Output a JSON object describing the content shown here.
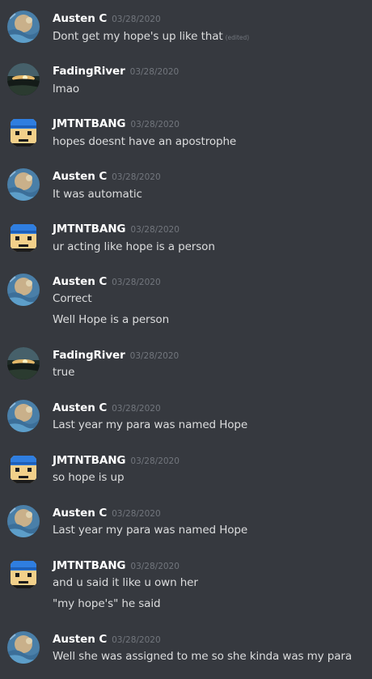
{
  "channel": {
    "edited_label": "(edited)"
  },
  "users": {
    "austen": {
      "name": "Austen C",
      "avatar": "abstract-blue-art-icon"
    },
    "fading": {
      "name": "FadingRiver",
      "avatar": "sunset-landscape-icon"
    },
    "jmtnt": {
      "name": "JMTNTBANG",
      "avatar": "pixel-character-icon"
    }
  },
  "messages": [
    {
      "author": "Austen C",
      "timestamp": "03/28/2020",
      "lines": [
        "Dont get my hope's up like that"
      ],
      "edited": true
    },
    {
      "author": "FadingRiver",
      "timestamp": "03/28/2020",
      "lines": [
        "lmao"
      ]
    },
    {
      "author": "JMTNTBANG",
      "timestamp": "03/28/2020",
      "lines": [
        "hopes doesnt have an apostrophe"
      ]
    },
    {
      "author": "Austen C",
      "timestamp": "03/28/2020",
      "lines": [
        "It was automatic"
      ]
    },
    {
      "author": "JMTNTBANG",
      "timestamp": "03/28/2020",
      "lines": [
        "ur acting like hope is a person"
      ]
    },
    {
      "author": "Austen C",
      "timestamp": "03/28/2020",
      "lines": [
        "Correct",
        "Well Hope is a person"
      ]
    },
    {
      "author": "FadingRiver",
      "timestamp": "03/28/2020",
      "lines": [
        "true"
      ]
    },
    {
      "author": "Austen C",
      "timestamp": "03/28/2020",
      "lines": [
        "Last year my para was named Hope"
      ]
    },
    {
      "author": "JMTNTBANG",
      "timestamp": "03/28/2020",
      "lines": [
        "so hope is up"
      ]
    },
    {
      "author": "Austen C",
      "timestamp": "03/28/2020",
      "lines": [
        "Last year my para was named Hope"
      ]
    },
    {
      "author": "JMTNTBANG",
      "timestamp": "03/28/2020",
      "lines": [
        "and u said it like u own her",
        "\"my hope's\" he said"
      ]
    },
    {
      "author": "Austen C",
      "timestamp": "03/28/2020",
      "lines": [
        "Well she was assigned to me so she kinda was my para"
      ]
    }
  ]
}
